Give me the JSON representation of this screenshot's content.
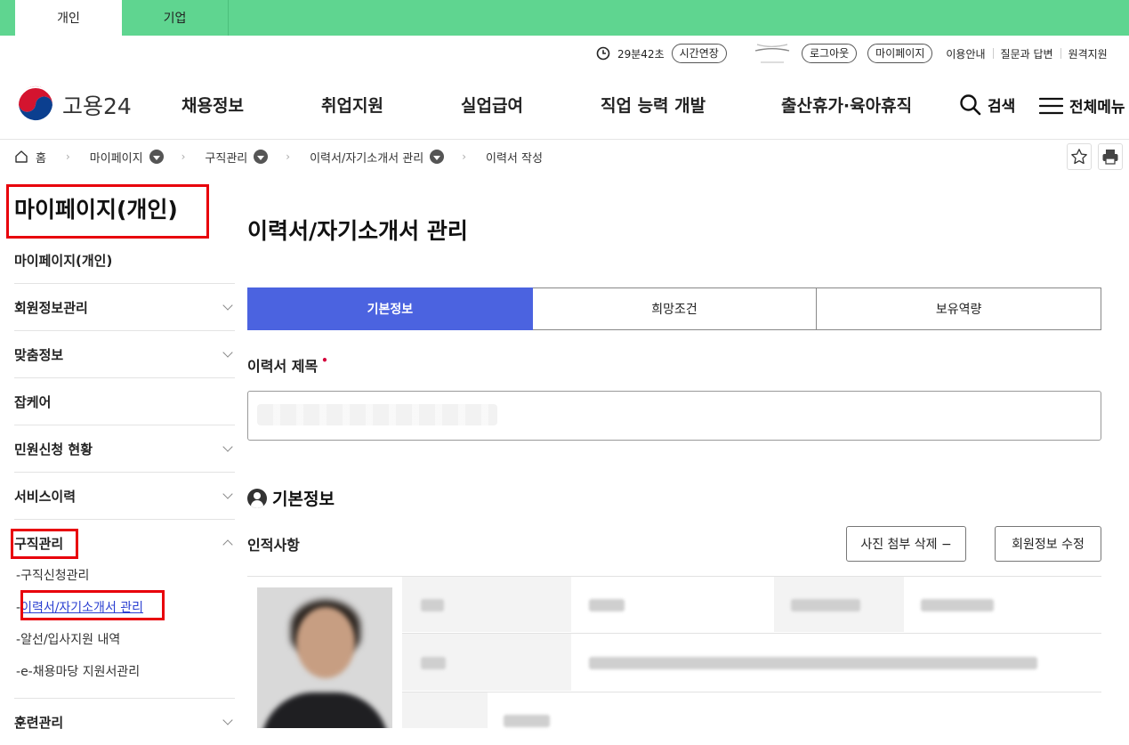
{
  "top_tabs": [
    {
      "label": "개인"
    },
    {
      "label": "기업"
    }
  ],
  "util": {
    "timer": "29분42초",
    "extend": "시간연장",
    "logout": "로그아웃",
    "mypage": "마이페이지",
    "links": [
      "이용안내",
      "질문과 답변",
      "원격지원"
    ]
  },
  "header": {
    "logo_text": "고용24",
    "nav": [
      "채용정보",
      "취업지원",
      "실업급여",
      "직업 능력 개발",
      "출산휴가·육아휴직"
    ],
    "search": "검색",
    "menu": "전체메뉴"
  },
  "breadcrumb": {
    "home": "홈",
    "items": [
      "마이페이지",
      "구직관리",
      "이력서/자기소개서 관리",
      "이력서 작성"
    ]
  },
  "sidebar": {
    "title": "마이페이지(개인)",
    "sub": "마이페이지(개인)",
    "items": [
      "회원정보관리",
      "맞춤정보",
      "잡케어",
      "민원신청 현황",
      "서비스이력",
      "구직관리"
    ],
    "sub_links": [
      "구직신청관리",
      "이력서/자기소개서 관리",
      "알선/입사지원 내역",
      "e-채용마당 지원서관리"
    ],
    "last": "훈련관리"
  },
  "main": {
    "title": "이력서/자기소개서 관리",
    "tabs": [
      "기본정보",
      "희망조건",
      "보유역량"
    ],
    "resume_title_label": "이력서 제목",
    "required_mark": "•",
    "section_title": "기본정보",
    "sub_title": "인적사항",
    "btn_photo_delete": "사진 첨부 삭제 −",
    "btn_edit_member": "회원정보 수정"
  },
  "colors": {
    "topbar": "#5fd590",
    "tab_active": "#4b63e0",
    "highlight_box": "#e8000b",
    "current_link": "#2a3fd1"
  }
}
